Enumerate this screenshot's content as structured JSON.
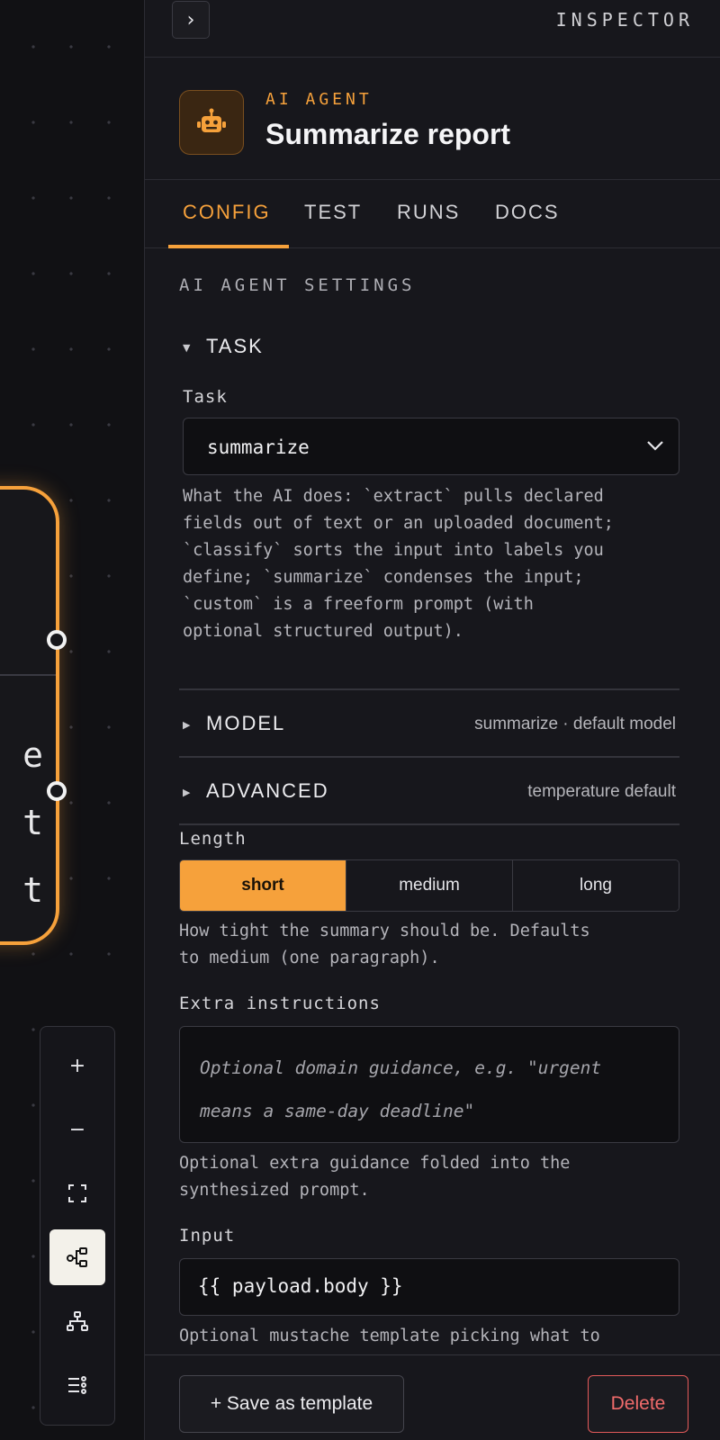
{
  "canvas": {
    "node_text_lines": [
      "e",
      "t",
      "t"
    ],
    "controls": [
      {
        "name": "zoom-in-button",
        "glyph": "+"
      },
      {
        "name": "zoom-out-button",
        "glyph": "−"
      },
      {
        "name": "fit-view-button",
        "glyph": ""
      },
      {
        "name": "flow-layout-button",
        "glyph": ""
      },
      {
        "name": "tree-layout-button",
        "glyph": ""
      },
      {
        "name": "list-view-button",
        "glyph": ""
      }
    ]
  },
  "inspector": {
    "label": "INSPECTOR",
    "collapse_glyph": "›",
    "header": {
      "eyebrow": "AI AGENT",
      "title": "Summarize report",
      "icon": "robot-icon"
    },
    "tabs": [
      {
        "label": "CONFIG",
        "active": true
      },
      {
        "label": "TEST",
        "active": false
      },
      {
        "label": "RUNS",
        "active": false
      },
      {
        "label": "DOCS",
        "active": false
      }
    ],
    "section_title": "AI AGENT SETTINGS",
    "task": {
      "heading": "TASK",
      "field_label": "Task",
      "value": "summarize",
      "help": "What the AI does: `extract` pulls declared\nfields out of text or an uploaded document;\n`classify` sorts the input into labels you\ndefine; `summarize` condenses the input;\n`custom` is a freeform prompt (with\noptional structured output)."
    },
    "model": {
      "heading": "MODEL",
      "summary": "summarize · default model"
    },
    "advanced": {
      "heading": "ADVANCED",
      "summary": "temperature default"
    },
    "length": {
      "label": "Length",
      "options": [
        "short",
        "medium",
        "long"
      ],
      "selected": "short",
      "help": "How tight the summary should be. Defaults\nto medium (one paragraph)."
    },
    "extra": {
      "label": "Extra instructions",
      "placeholder": "Optional domain guidance, e.g. \"urgent means a same-day deadline\"",
      "help": "Optional extra guidance folded into the\nsynthesized prompt."
    },
    "input": {
      "label": "Input",
      "value": "{{ payload.body }}",
      "help": "Optional mustache template picking what to"
    },
    "footer": {
      "save_label": "+ Save as template",
      "delete_label": "Delete"
    },
    "colors": {
      "accent": "#f6a13b",
      "danger": "#e45a5a",
      "panel": "#17171c"
    }
  }
}
